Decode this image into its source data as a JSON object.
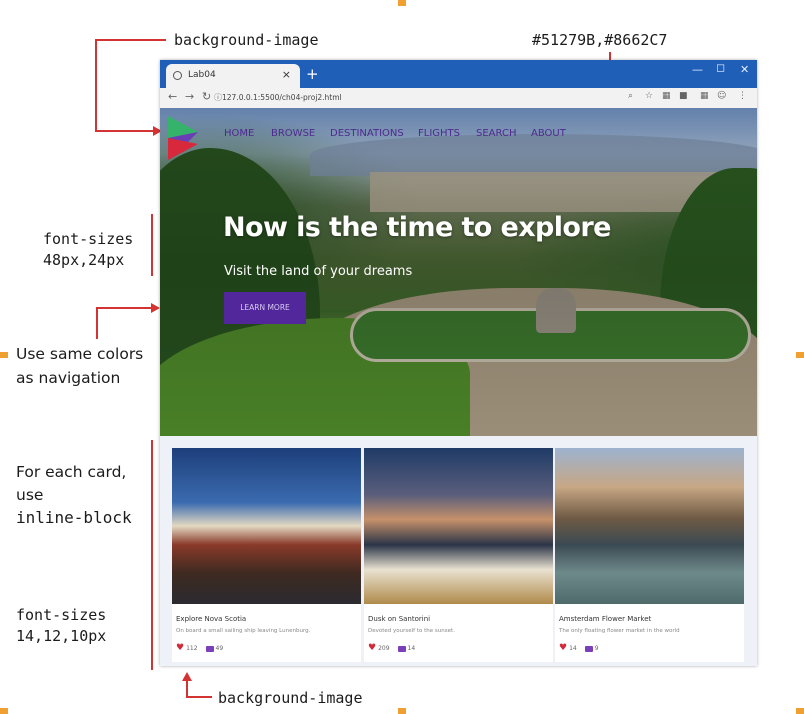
{
  "annotations": {
    "bg_image_top": "background-image",
    "nav_colors": "#51279B,#8662C7",
    "hero_font_sizes": [
      "font-sizes",
      "48px,24px"
    ],
    "button_colors": [
      "Use same colors",
      "as navigation"
    ],
    "card_layout": [
      "For each card,",
      "use",
      "inline-block"
    ],
    "card_font_sizes": [
      "font-sizes",
      "14,12,10px"
    ],
    "bg_image_bottom": "background-image"
  },
  "browser": {
    "tab_title": "Lab04",
    "tab_close": "×",
    "new_tab": "+",
    "url": "127.0.0.1:5500/ch04-proj2.html",
    "nav_icons": [
      "back-icon",
      "forward-icon",
      "reload-icon",
      "info-icon"
    ],
    "window_controls": [
      "minimize-icon",
      "maximize-icon",
      "close-icon"
    ]
  },
  "nav": {
    "items": [
      "HOME",
      "BROWSE",
      "DESTINATIONS",
      "FLIGHTS",
      "SEARCH",
      "ABOUT"
    ]
  },
  "hero": {
    "heading": "Now is the time to explore",
    "subheading": "Visit the land of your dreams",
    "button_label": "LEARN MORE"
  },
  "cards": [
    {
      "title": "Explore Nova Scotia",
      "description": "On board a small sailing ship leaving Lunenburg.",
      "likes": "112",
      "comments": "49"
    },
    {
      "title": "Dusk on Santorini",
      "description": "Devoted yourself to the sunset.",
      "likes": "209",
      "comments": "14"
    },
    {
      "title": "Amsterdam Flower Market",
      "description": "The only floating flower market in the world",
      "likes": "14",
      "comments": "9"
    }
  ],
  "colors": {
    "accent": "#51279B",
    "accent_light": "#8662C7",
    "callout": "#d43333",
    "chrome_blue": "#1f5fb8"
  }
}
